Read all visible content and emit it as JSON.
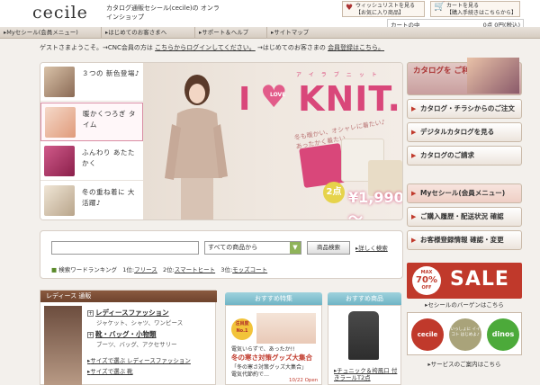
{
  "header": {
    "logo": "cecile",
    "tagline": "カタログ通販セシール(cecile)の オンラインショップ",
    "wishlist": {
      "line1": "ウィッシュリストを見る",
      "line2": "【お気に入り商品】"
    },
    "cart": {
      "line1": "カートを見る",
      "line2": "【購入手続きはこちらから】"
    },
    "cart_status": {
      "label": "カートの中",
      "value": "0点 0円(税込)"
    }
  },
  "nav": {
    "items": [
      "Myセシール(会員メニュー)",
      "はじめてのお客さまへ",
      "サポート＆ヘルプ",
      "サイトマップ"
    ]
  },
  "welcome": {
    "text1": "ゲストさまようこそ。→CNC会員の方は",
    "link1": "こちらからログインしてください。",
    "text2": "→はじめてのお客さまの",
    "link2": "会員登録はこちら。"
  },
  "hero": {
    "themes": [
      {
        "label": "３つの 新色登場♪"
      },
      {
        "label": "暖かくつろぎ タイム"
      },
      {
        "label": "ふんわり あたたかく"
      },
      {
        "label": "冬の重ね着に 大活躍♪"
      }
    ],
    "banner": {
      "i": "I",
      "heart_text": "LOVE",
      "word": "KNIT.",
      "ruby": "アイラブニット",
      "sub1": "冬も暖かい、オシャレに着たい♪",
      "sub2": "あったかく着たい",
      "price": "¥1,990～",
      "price_badge": "2点"
    }
  },
  "search": {
    "input_value": "",
    "select_value": "すべての商品から",
    "button": "商品検索",
    "detail": "詳しく検索",
    "ranking_label": "検索ワードランキング",
    "ranking": [
      {
        "rank": "1位:",
        "word": "フリース"
      },
      {
        "rank": "2位:",
        "word": "スマートヒート"
      },
      {
        "rank": "3位:",
        "word": "モッズコート"
      }
    ]
  },
  "ladies": {
    "title": "レディース 通販",
    "categories": [
      {
        "name": "レディースファッション",
        "sub": "ジャケット、シャツ、ワンピース"
      },
      {
        "name": "靴・バッグ・小物類",
        "sub": "ブーツ、バッグ、アクセサリー"
      }
    ],
    "links": [
      "サイズで選ぶ レディースファッション",
      "サイズで選ぶ 靴"
    ]
  },
  "featured": {
    "tab": "おすすめ特集",
    "badge": "注目度 No.1",
    "line1": "電気いらずで、あったか!!",
    "line2": "冬の寒さ対策グッズ大集合",
    "line3": "「冬の寒さ対策グッズ大集合」",
    "line4": "電気代節約で…",
    "date": "10/22 Open"
  },
  "recommended": {
    "tab": "おすすめ商品",
    "name": "チュニック＆袴風口 付きラールT2点"
  },
  "right": {
    "catalog_promo": "カタログを ご利用の お客さま",
    "catalog_buttons": [
      "カタログ・チラシからのご注文",
      "デジタルカタログを見る",
      "カタログのご請求"
    ],
    "member_buttons": [
      "Myセシール(会員メニュー)",
      "ご購入履歴・配送状況 確認",
      "お客様登録情報 確認・変更"
    ],
    "sale": {
      "badge_top": "MAX",
      "badge_pct": "70%",
      "badge_off": "OFF",
      "word": "SALE"
    },
    "sale_link": "セシールのバーゲンはこちら",
    "brands": [
      "cecile",
      "いっしょに イイコト はじめよ♪",
      "dinos"
    ],
    "brand_link": "サービスのご案内はこちら"
  },
  "colors": {
    "accent": "#c0392b",
    "pink": "#d9477a",
    "tab": "#6fb4c5",
    "ladies_head": "#6e432d"
  }
}
